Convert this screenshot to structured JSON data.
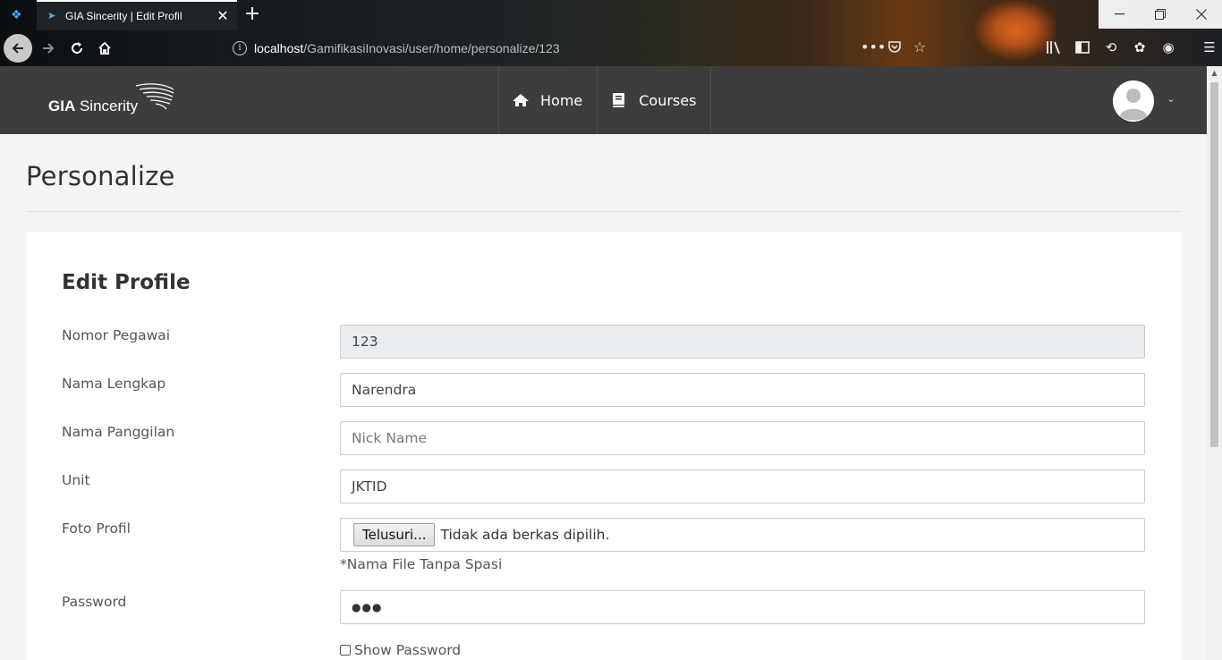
{
  "browser": {
    "tab_title": "GIA Sincerity | Edit Profil",
    "tab_close": "✕",
    "new_tab": "+",
    "url_host": "localhost",
    "url_path": "/GamifikasiInovasi/user/home/personalize/123",
    "window_controls": [
      "minimize",
      "restore",
      "close"
    ]
  },
  "site": {
    "logo_bold": "GIA",
    "logo_rest": " Sincerity",
    "nav": [
      {
        "label": "Home",
        "icon": "home-icon"
      },
      {
        "label": "Courses",
        "icon": "book-icon"
      }
    ],
    "avatar_icon": "user-avatar-icon"
  },
  "page": {
    "title": "Personalize"
  },
  "form": {
    "title": "Edit Profile",
    "nomor_pegawai": {
      "label": "Nomor Pegawai",
      "value": "123"
    },
    "nama_lengkap": {
      "label": "Nama Lengkap",
      "value": "Narendra"
    },
    "nama_panggilan": {
      "label": "Nama Panggilan",
      "placeholder": "Nick Name"
    },
    "unit": {
      "label": "Unit",
      "value": "JKTID"
    },
    "foto_profil": {
      "label": "Foto Profil",
      "button": "Telusuri...",
      "status": "Tidak ada berkas dipilih.",
      "help": "*Nama File Tanpa Spasi"
    },
    "password": {
      "label": "Password",
      "value": "●●●"
    },
    "show_password": {
      "label": "Show Password",
      "checked": false
    }
  }
}
